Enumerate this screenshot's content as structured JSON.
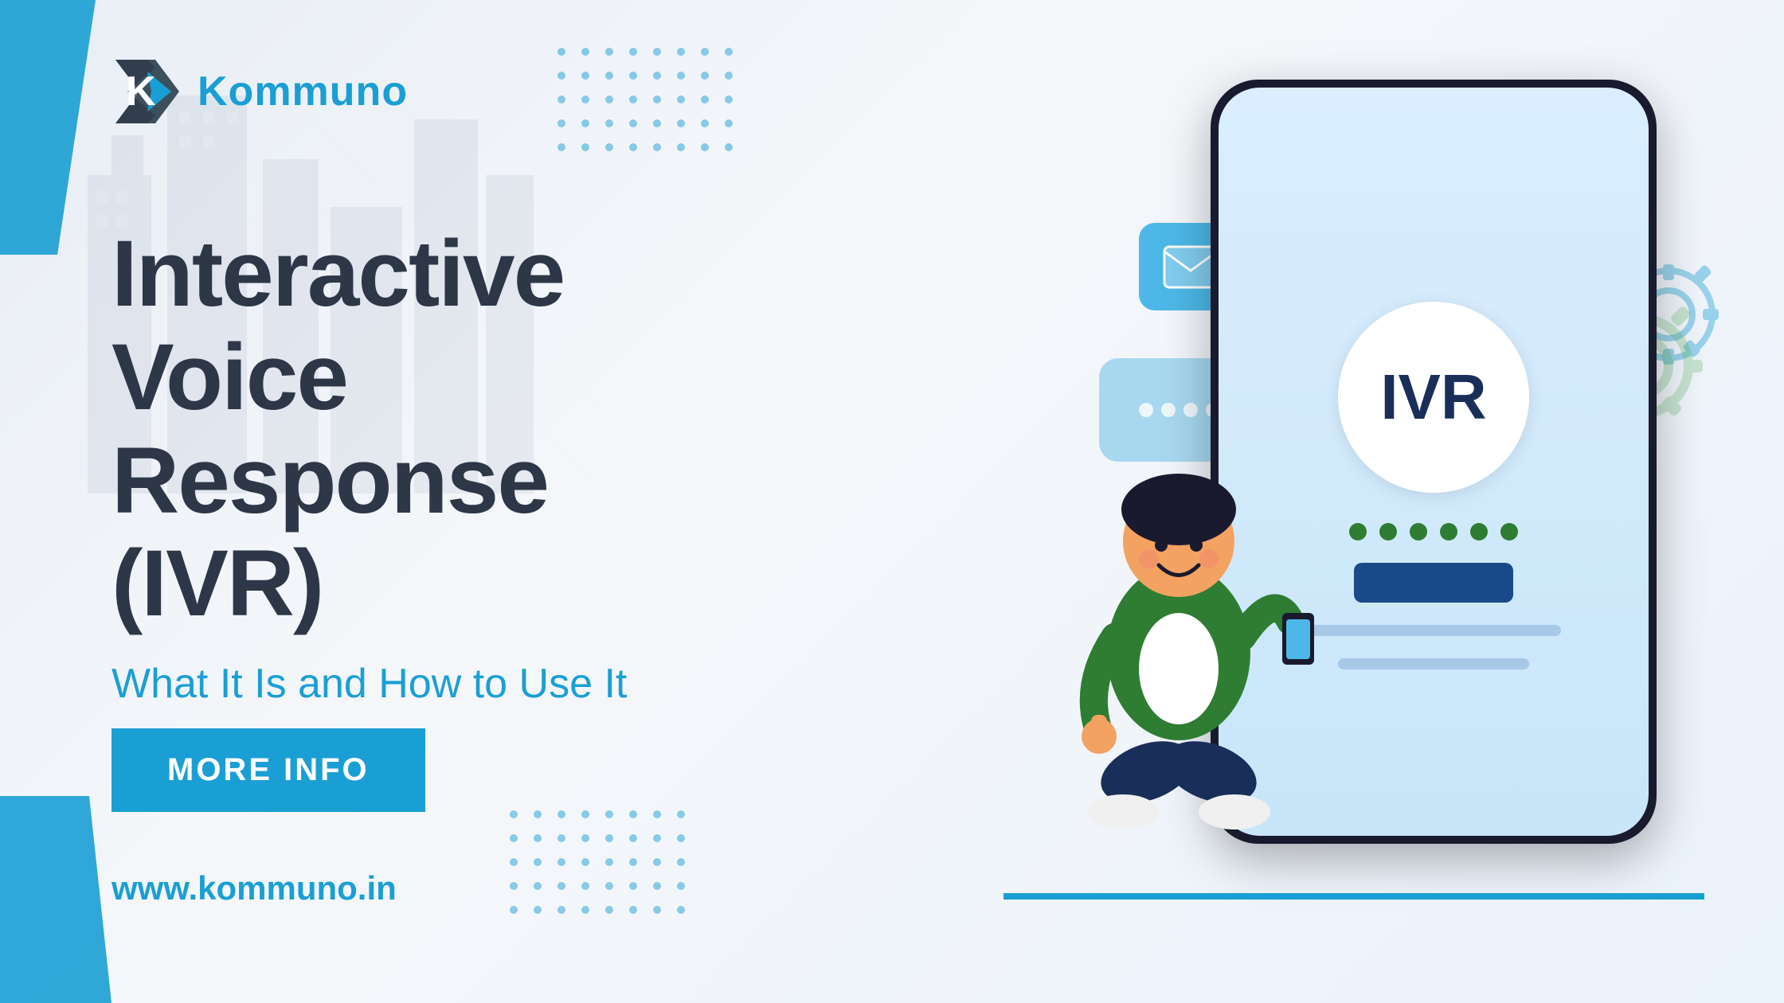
{
  "logo": {
    "brand_name_k": "K",
    "brand_name_rest": "omm",
    "brand_name_u": "u",
    "brand_name_no": "no",
    "full_name": "Kommuno"
  },
  "headline": {
    "line1": "Interactive Voice",
    "line2": "Response (IVR)"
  },
  "subheadline": {
    "text": "What It Is and How to Use It"
  },
  "cta_button": {
    "label": "MORE INFO"
  },
  "website": {
    "url": "www.kommuno.in"
  },
  "phone_screen": {
    "ivr_label": "IVR"
  },
  "colors": {
    "brand_blue": "#1a9fd4",
    "dark": "#2d3748",
    "phone_dark": "#1a1a2e",
    "screen_bg": "#daeeff"
  }
}
